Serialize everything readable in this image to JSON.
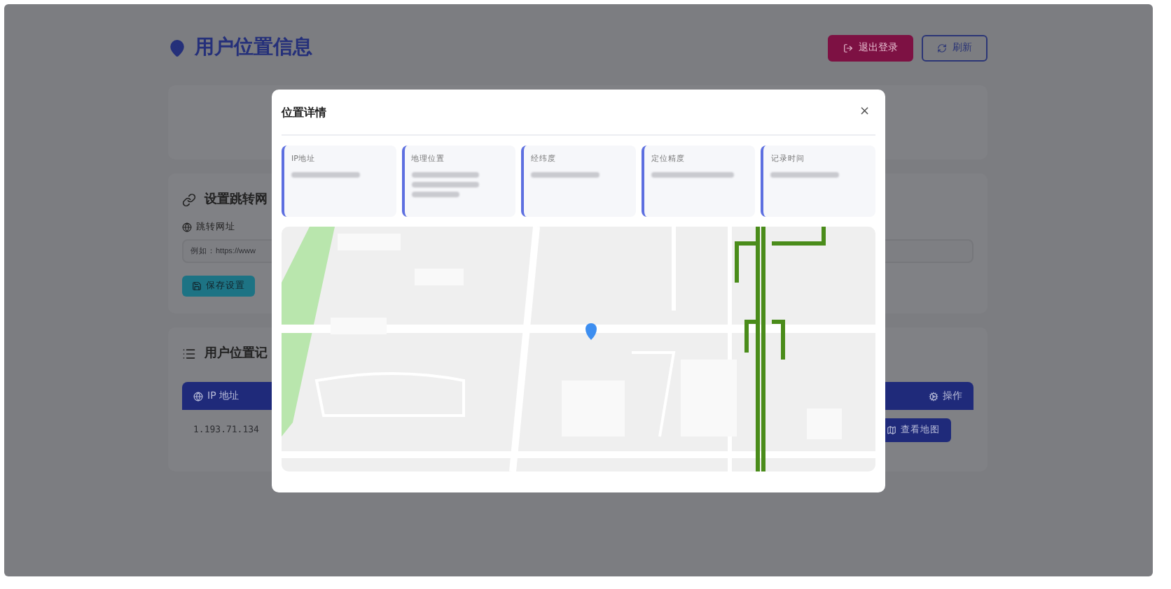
{
  "page": {
    "title": "用户位置信息",
    "buttons": [
      {
        "kind": "logout",
        "label": "退出登录"
      },
      {
        "kind": "refresh",
        "label": "刷新"
      }
    ]
  },
  "redirect_card": {
    "title": "设置跳转网",
    "field_label": "跳转网址",
    "placeholder": "例如：https://www",
    "save_button": "保存设置"
  },
  "records_card": {
    "title": "用户位置记",
    "columns": [
      "IP 地址",
      "操作"
    ],
    "rows": [
      {
        "ip": "1.193.71.134",
        "action": "查看地图"
      }
    ]
  },
  "modal": {
    "title": "位置详情",
    "close": "×",
    "fields": [
      {
        "label": "IP地址"
      },
      {
        "label": "地理位置"
      },
      {
        "label": "经纬度"
      },
      {
        "label": "定位精度"
      },
      {
        "label": "记录时间"
      }
    ]
  }
}
